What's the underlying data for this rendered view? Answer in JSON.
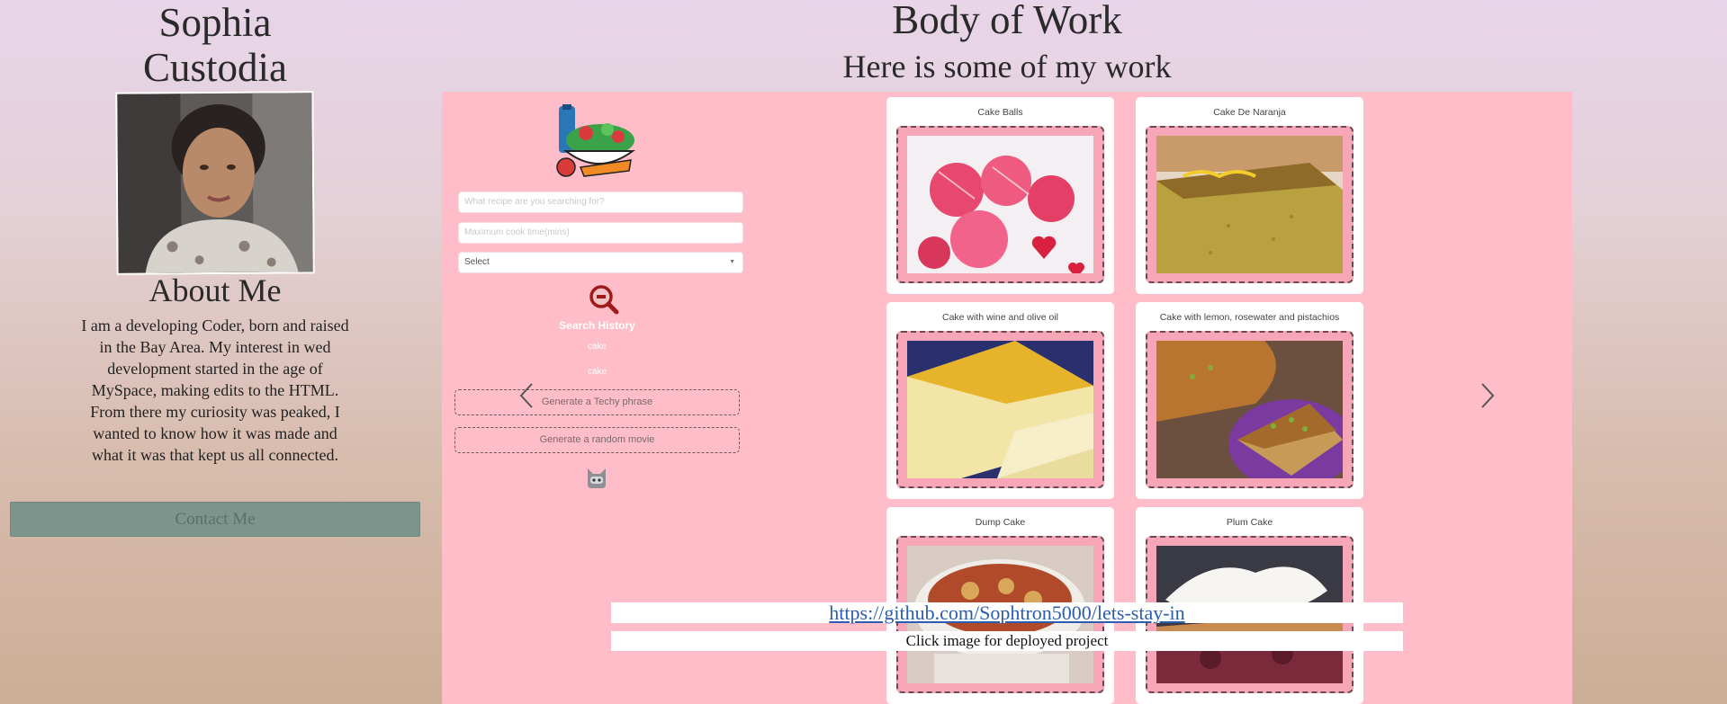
{
  "profile": {
    "name_line1": "Sophia",
    "name_line2": "Custodia"
  },
  "about": {
    "heading": "About Me",
    "text": "I am a developing Coder, born and raised in the Bay Area. My interest in wed development started in the age of MySpace, making edits to the HTML. From there my curiosity was peaked, I wanted to know how it was made and what it was that kept us all connected.",
    "contact_label": "Contact Me"
  },
  "work": {
    "title": "Body of Work",
    "subtitle": "Here is some of my work"
  },
  "app": {
    "search_placeholder": "What recipe are you searching for?",
    "time_placeholder": "Maximum cook time(mins)",
    "select_value": "Select",
    "history_title": "Search History",
    "history_items": [
      "cake",
      "cake"
    ],
    "techy_button": "Generate a Techy phrase",
    "movie_button": "Generate a random movie"
  },
  "recipes": [
    {
      "title": "Cake Balls"
    },
    {
      "title": "Cake De Naranja"
    },
    {
      "title": "Cake with wine and olive oil"
    },
    {
      "title": "Cake with lemon, rosewater and pistachios"
    },
    {
      "title": "Dump Cake"
    },
    {
      "title": "Plum Cake"
    }
  ],
  "project": {
    "link": "https://github.com/Sophtron5000/lets-stay-in",
    "caption": "Click image for deployed project"
  },
  "icons": {
    "prev": "chevron-left-icon",
    "next": "chevron-right-icon"
  },
  "colors": {
    "carousel_bg": "#ffbcc9",
    "contact_bg": "#7d948d",
    "link": "#2a5db0"
  }
}
